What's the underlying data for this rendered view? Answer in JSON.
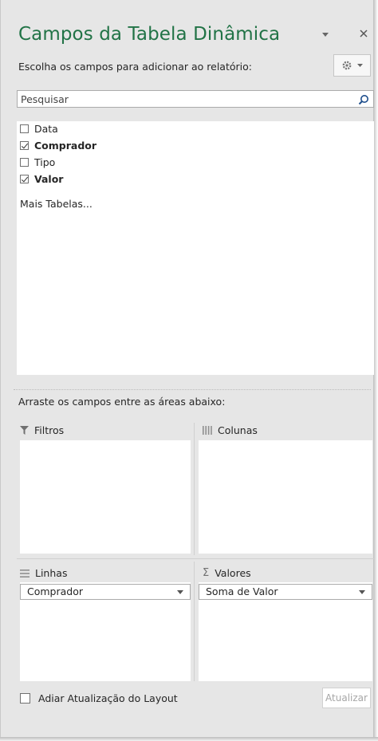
{
  "panel": {
    "title": "Campos da Tabela Dinâmica",
    "instruction": "Escolha os campos para adicionar ao relatório:"
  },
  "search": {
    "placeholder": "Pesquisar"
  },
  "fields": [
    {
      "label": "Data",
      "checked": false
    },
    {
      "label": "Comprador",
      "checked": true
    },
    {
      "label": "Tipo",
      "checked": false
    },
    {
      "label": "Valor",
      "checked": true
    }
  ],
  "more_tables": "Mais Tabelas...",
  "drag_instruction": "Arraste os campos entre as áreas abaixo:",
  "areas": {
    "filters": {
      "label": "Filtros",
      "icon": "filter-icon"
    },
    "columns": {
      "label": "Colunas",
      "icon": "columns-icon"
    },
    "rows": {
      "label": "Linhas",
      "icon": "rows-icon",
      "item": "Comprador"
    },
    "values": {
      "label": "Valores",
      "icon": "sigma-icon",
      "item": "Soma de Valor"
    }
  },
  "footer": {
    "defer_label": "Adiar Atualização do Layout",
    "update_button": "Atualizar"
  },
  "colors": {
    "accent": "#217346",
    "background": "#e6e6e6"
  }
}
